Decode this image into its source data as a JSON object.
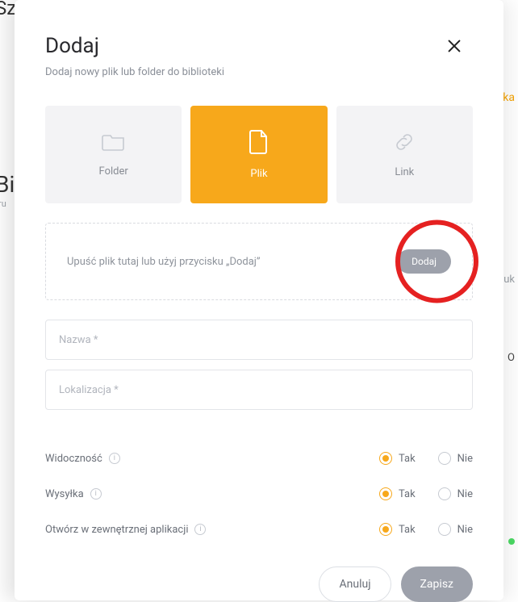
{
  "modal": {
    "title": "Dodaj",
    "subtitle": "Dodaj nowy plik lub folder do biblioteki",
    "tiles": {
      "folder": "Folder",
      "file": "Plik",
      "link": "Link"
    },
    "drop": {
      "hint": "Upuść plik tutaj lub użyj przycisku „Dodaj”",
      "add": "Dodaj"
    },
    "inputs": {
      "name_placeholder": "Nazwa *",
      "location_placeholder": "Lokalizacja *"
    },
    "options": {
      "visibility": "Widoczność",
      "shipping": "Wysyłka",
      "external": "Otwórz w zewnętrznej aplikacji",
      "yes": "Tak",
      "no": "Nie"
    },
    "footer": {
      "cancel": "Anuluj",
      "save": "Zapisz"
    }
  },
  "bg": {
    "tl": "Sz",
    "bi": "Bi",
    "ru": "ru",
    "ka": "ka",
    "szuk": "Szuk",
    "o": "O"
  }
}
